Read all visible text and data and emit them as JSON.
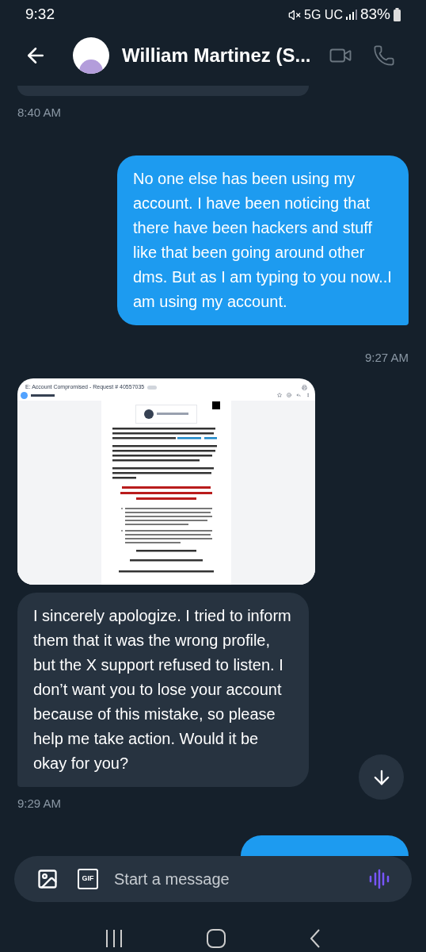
{
  "status_bar": {
    "time": "9:32",
    "network": "5G UC",
    "battery": "83%"
  },
  "header": {
    "name": "William Martinez (S..."
  },
  "messages": [
    {
      "kind": "received_cut"
    },
    {
      "kind": "time_received",
      "text": "8:40 AM"
    },
    {
      "kind": "sent",
      "text": "No one else has been using my account. I have been noticing that there have been hackers and stuff like that been going around other dms. But as I am typing to you now..I am using my account."
    },
    {
      "kind": "time_sent",
      "text": "9:27 AM"
    },
    {
      "kind": "image",
      "email": {
        "subject": "E: Account Compromised - Request # 40557035"
      }
    },
    {
      "kind": "received",
      "text": "I sincerely apologize. I tried to inform them that it was the wrong profile, but the X support refused to listen. I don’t want you to lose your account because of this mistake, so please help me take action. Would it be okay for you?"
    },
    {
      "kind": "time_received",
      "text": "9:29 AM"
    },
    {
      "kind": "sent_cut"
    }
  ],
  "composer": {
    "placeholder": "Start a message",
    "gif_label": "GIF"
  }
}
